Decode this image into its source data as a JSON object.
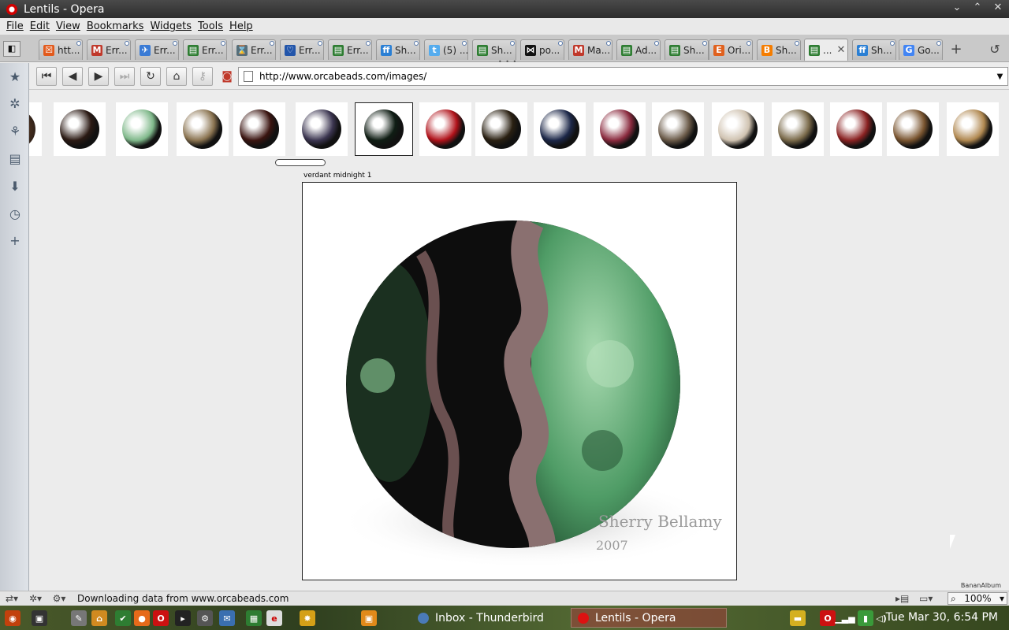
{
  "window": {
    "title": "Lentils - Opera",
    "controls": [
      "⌄",
      "⌃",
      "✕"
    ]
  },
  "menu": [
    "File",
    "Edit",
    "View",
    "Bookmarks",
    "Widgets",
    "Tools",
    "Help"
  ],
  "tabs": [
    {
      "label": "htt...",
      "color": "#e25a1c",
      "glyph": "☒"
    },
    {
      "label": "Err...",
      "color": "#c0392b",
      "glyph": "M"
    },
    {
      "label": "Err...",
      "color": "#3a7bd5",
      "glyph": "✈"
    },
    {
      "label": "Err...",
      "color": "#2e7d32",
      "glyph": "▤"
    },
    {
      "label": "Err...",
      "color": "#546e7a",
      "glyph": "⌛"
    },
    {
      "label": "Err...",
      "color": "#2255aa",
      "glyph": "♡"
    },
    {
      "label": "Err...",
      "color": "#2e7d32",
      "glyph": "▤"
    },
    {
      "label": "Sh...",
      "color": "#2a7fd4",
      "glyph": "ff"
    },
    {
      "label": "(5) ...",
      "color": "#55acee",
      "glyph": "t"
    },
    {
      "label": "Sh...",
      "color": "#2e7d32",
      "glyph": "▤"
    },
    {
      "label": "po...",
      "color": "#111111",
      "glyph": "⋈"
    },
    {
      "label": "Ma...",
      "color": "#c0392b",
      "glyph": "M"
    },
    {
      "label": "Ad...",
      "color": "#2e7d32",
      "glyph": "▤"
    },
    {
      "label": "Sh...",
      "color": "#2e7d32",
      "glyph": "▤"
    },
    {
      "label": "Ori...",
      "color": "#e0611e",
      "glyph": "E"
    },
    {
      "label": "Sh...",
      "color": "#f57d00",
      "glyph": "B"
    },
    {
      "label": "...",
      "color": "#2e7d32",
      "glyph": "▤",
      "active": true
    },
    {
      "label": "Sh...",
      "color": "#2a7fd4",
      "glyph": "ff"
    },
    {
      "label": "Go...",
      "color": "#4285f4",
      "glyph": "G"
    }
  ],
  "address": {
    "url": "http://www.orcabeads.com/images/"
  },
  "gallery": {
    "caption": "verdant midnight 1",
    "credit": "BananAlbum",
    "watermark_name": "Sherry Bellamy",
    "watermark_year": "2007",
    "beads": [
      "#2b1a14",
      "#7fb88a",
      "#8a7350",
      "#3a1410",
      "#3b3550",
      "#0f1d14",
      "#b0121a",
      "#2a2012",
      "#1c2748",
      "#8a2a3e",
      "#6a5a48",
      "#cfc2b0",
      "#7a6a4a",
      "#8a2222",
      "#7a5530",
      "#b08850"
    ]
  },
  "status": {
    "text": "Downloading data from www.orcabeads.com",
    "zoom": "100%"
  },
  "taskbar": {
    "tasks": [
      "Inbox - Thunderbird",
      "Lentils - Opera"
    ],
    "clock": "Tue Mar 30,  6:54 PM"
  }
}
